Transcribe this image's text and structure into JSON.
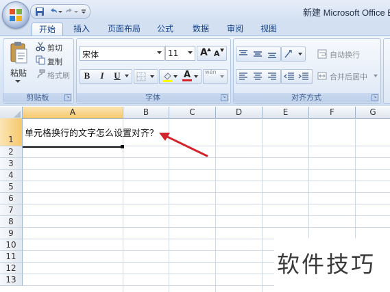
{
  "window": {
    "title": "新建 Microsoft Office Ex"
  },
  "quick_access": {
    "icons": [
      "save-icon",
      "undo-icon",
      "redo-icon",
      "customize-icon"
    ]
  },
  "tabs": [
    "开始",
    "插入",
    "页面布局",
    "公式",
    "数据",
    "审阅",
    "视图"
  ],
  "active_tab": "开始",
  "clipboard": {
    "paste_label": "粘贴",
    "cut_label": "剪切",
    "copy_label": "复制",
    "format_painter_label": "格式刷",
    "group_label": "剪贴板"
  },
  "font": {
    "font_name": "宋体",
    "font_size": "11",
    "grow_label": "A",
    "shrink_label": "A",
    "bold_label": "B",
    "italic_label": "I",
    "underline_label": "U",
    "font_color_label": "A",
    "phonetic_label": "wén",
    "group_label": "字体"
  },
  "alignment": {
    "wrap_text_label": "自动换行",
    "merge_center_label": "合并后居中",
    "group_label": "对齐方式"
  },
  "sheet": {
    "columns": [
      "A",
      "B",
      "C",
      "D",
      "E",
      "F",
      "G"
    ],
    "rows": [
      "1",
      "2",
      "3",
      "4",
      "5",
      "6",
      "7",
      "8",
      "9",
      "10",
      "11",
      "12",
      "13"
    ],
    "active_cell": "A1",
    "cell_a1": "单元格换行的文字怎么设置对齐？"
  },
  "watermark": {
    "text": "软件技巧"
  },
  "colors": {
    "accent": "#15428b",
    "arrow": "#d3242b",
    "selected_header": "#f6c86b"
  }
}
